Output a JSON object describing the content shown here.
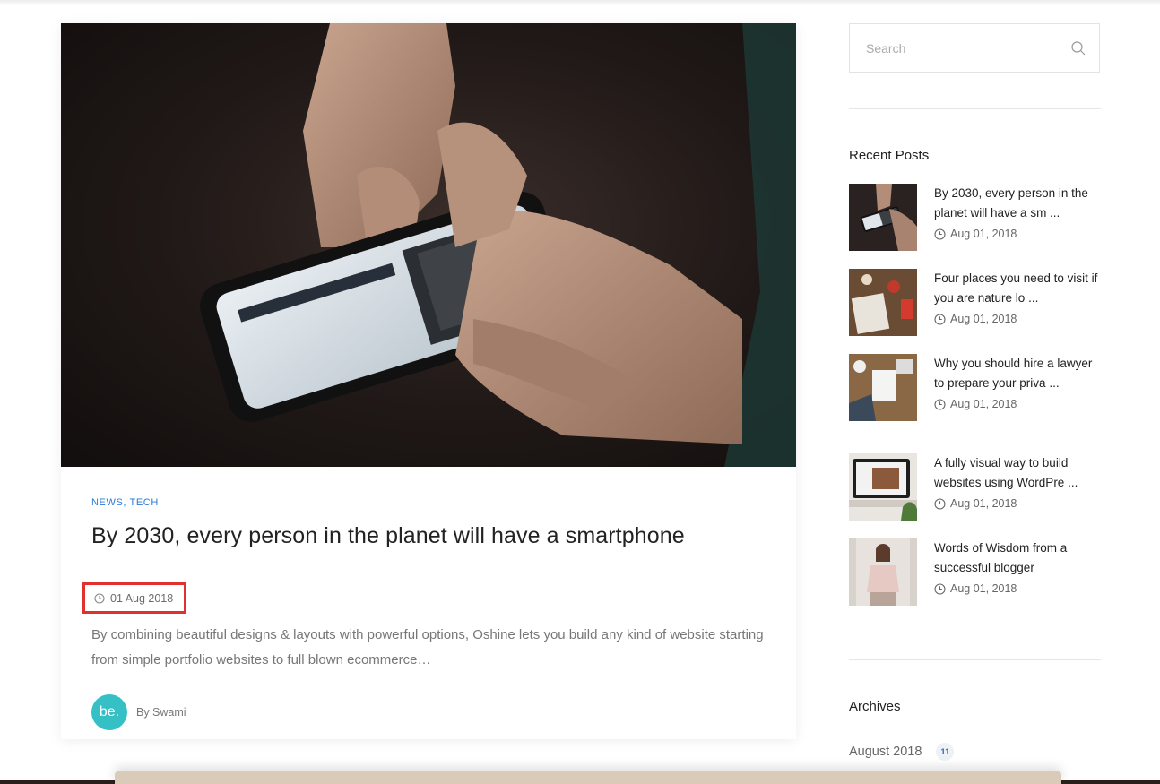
{
  "post": {
    "categories": [
      "NEWS",
      "TECH"
    ],
    "category_separator": ",",
    "title": "By 2030, every person in the planet will have a smartphone",
    "date": "01 Aug 2018",
    "excerpt": "By combining beautiful designs & layouts with powerful options, Oshine lets you build any kind of website starting from simple portfolio websites to full blown ecommerce…",
    "author_avatar_text": "be.",
    "author": "By Swami"
  },
  "sidebar": {
    "search_placeholder": "Search",
    "recent_posts_title": "Recent Posts",
    "recent_posts": [
      {
        "title": "By 2030, every person in the planet will have a sm ...",
        "date": "Aug 01, 2018"
      },
      {
        "title": "Four places you need to visit if you are nature lo ...",
        "date": "Aug 01, 2018"
      },
      {
        "title": "Why you should hire a lawyer to prepare your priva ...",
        "date": "Aug 01, 2018"
      },
      {
        "title": "A fully visual way to build websites using WordPre ...",
        "date": "Aug 01, 2018"
      },
      {
        "title": "Words of Wisdom from a successful blogger",
        "date": "Aug 01, 2018"
      }
    ],
    "archives_title": "Archives",
    "archives": [
      {
        "label": "August 2018",
        "count": "11"
      }
    ]
  },
  "colors": {
    "accent": "#2a7ad6",
    "highlight_border": "#e03030",
    "avatar": "#35c0c6"
  }
}
